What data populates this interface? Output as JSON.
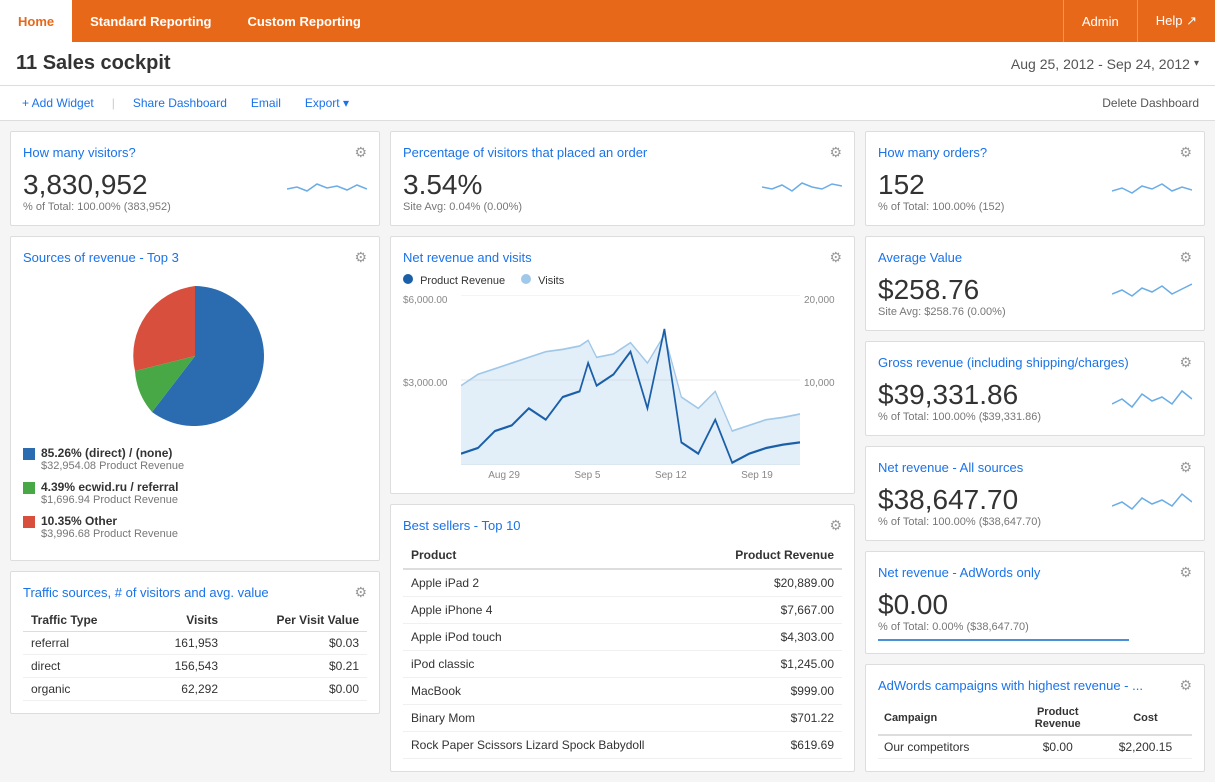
{
  "nav": {
    "items_left": [
      {
        "label": "Home",
        "active": true
      },
      {
        "label": "Standard Reporting",
        "active": false
      },
      {
        "label": "Custom Reporting",
        "active": false
      }
    ],
    "items_right": [
      {
        "label": "Admin"
      },
      {
        "label": "Help ↗"
      }
    ]
  },
  "header": {
    "title": "11 Sales cockpit",
    "date_range": "Aug 25, 2012 - Sep 24, 2012"
  },
  "toolbar": {
    "add_widget": "+ Add Widget",
    "share_dashboard": "Share Dashboard",
    "email": "Email",
    "export": "Export ▾",
    "delete_dashboard": "Delete Dashboard"
  },
  "visitors_widget": {
    "title": "How many visitors?",
    "value": "3,830,952",
    "sub": "% of Total: 100.00% (383,952)"
  },
  "conversion_widget": {
    "title": "Percentage of visitors that placed an order",
    "value": "3.54%",
    "sub": "Site Avg: 0.04% (0.00%)"
  },
  "orders_widget": {
    "title": "How many orders?",
    "value": "152",
    "sub": "% of Total: 100.00% (152)"
  },
  "sources_widget": {
    "title": "Sources of revenue - Top 3",
    "legend": [
      {
        "color": "#2b6cb0",
        "label": "85.26% (direct) / (none)",
        "sub": "$32,954.08 Product Revenue"
      },
      {
        "color": "#48a846",
        "label": "4.39% ecwid.ru / referral",
        "sub": "$1,696.94 Product Revenue"
      },
      {
        "color": "#d94f3d",
        "label": "10.35% Other",
        "sub": "$3,996.68 Product Revenue"
      }
    ]
  },
  "avg_value_widget": {
    "title": "Average Value",
    "value": "$258.76",
    "sub": "Site Avg: $258.76 (0.00%)"
  },
  "gross_revenue_widget": {
    "title": "Gross revenue (including shipping/charges)",
    "value": "$39,331.86",
    "sub": "% of Total: 100.00% ($39,331.86)"
  },
  "net_revenue_all_widget": {
    "title": "Net revenue - All sources",
    "value": "$38,647.70",
    "sub": "% of Total: 100.00% ($38,647.70)"
  },
  "net_revenue_adwords_widget": {
    "title": "Net revenue - AdWords only",
    "value": "$0.00",
    "sub": "% of Total: 0.00% ($38,647.70)"
  },
  "adwords_campaigns_widget": {
    "title": "AdWords campaigns with highest revenue - ...",
    "columns": [
      "Campaign",
      "Product Revenue",
      "Cost"
    ],
    "rows": [
      {
        "campaign": "Our competitors",
        "revenue": "$0.00",
        "cost": "$2,200.15"
      }
    ]
  },
  "net_revenue_chart": {
    "title": "Net revenue and visits",
    "legend": [
      {
        "color": "#1a5fa8",
        "label": "Product Revenue"
      },
      {
        "color": "#a0c8e8",
        "label": "Visits"
      }
    ],
    "x_labels": [
      "Aug 29",
      "Sep 5",
      "Sep 12",
      "Sep 19"
    ],
    "y_left": [
      "$6,000.00",
      "$3,000.00",
      ""
    ],
    "y_right": [
      "20,000",
      "10,000",
      ""
    ]
  },
  "best_sellers_widget": {
    "title": "Best sellers - Top 10",
    "columns": [
      "Product",
      "Product Revenue"
    ],
    "rows": [
      {
        "product": "Apple iPad 2",
        "revenue": "$20,889.00"
      },
      {
        "product": "Apple iPhone 4",
        "revenue": "$7,667.00"
      },
      {
        "product": "Apple iPod touch",
        "revenue": "$4,303.00"
      },
      {
        "product": "iPod classic",
        "revenue": "$1,245.00"
      },
      {
        "product": "MacBook",
        "revenue": "$999.00"
      },
      {
        "product": "Binary Mom",
        "revenue": "$701.22"
      },
      {
        "product": "Rock Paper Scissors Lizard Spock Babydoll",
        "revenue": "$619.69"
      }
    ]
  },
  "traffic_sources_widget": {
    "title": "Traffic sources, # of visitors and avg. value",
    "columns": [
      "Traffic Type",
      "Visits",
      "Per Visit Value"
    ],
    "rows": [
      {
        "type": "referral",
        "visits": "161,953",
        "value": "$0.03"
      },
      {
        "type": "direct",
        "visits": "156,543",
        "value": "$0.21"
      },
      {
        "type": "organic",
        "visits": "62,292",
        "value": "$0.00"
      }
    ]
  }
}
